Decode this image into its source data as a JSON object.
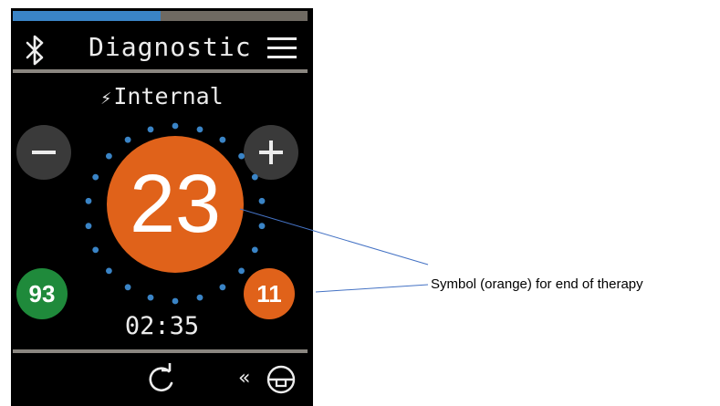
{
  "device": {
    "progress": 0.5,
    "header": {
      "title": "Diagnostic",
      "left_icon": "bluetooth-icon",
      "right_icon": "hamburger-menu-icon"
    },
    "power_source": {
      "icon": "lightning-bolt-icon",
      "icon_glyph": "⚡",
      "label": "Internal"
    },
    "controls": {
      "decrease_icon": "minus-icon",
      "increase_icon": "plus-icon"
    },
    "main_value": "23",
    "left_badge": {
      "value": "93",
      "color": "#1f8a3b"
    },
    "right_badge": {
      "value": "11",
      "color": "#e0621a"
    },
    "time": "02:35",
    "footer": {
      "refresh_icon": "refresh-icon",
      "chevron_glyph": "«",
      "lock_icon": "lock-circle-icon"
    }
  },
  "annotation": {
    "text": "Symbol (orange) for end of therapy"
  },
  "colors": {
    "screen_bg": "#000000",
    "progress_fill": "#3a84c6",
    "progress_track": "#6f6a62",
    "accent_orange": "#e0621a",
    "ring_dots": "#3a84c6",
    "callout_line": "#4472c4"
  }
}
